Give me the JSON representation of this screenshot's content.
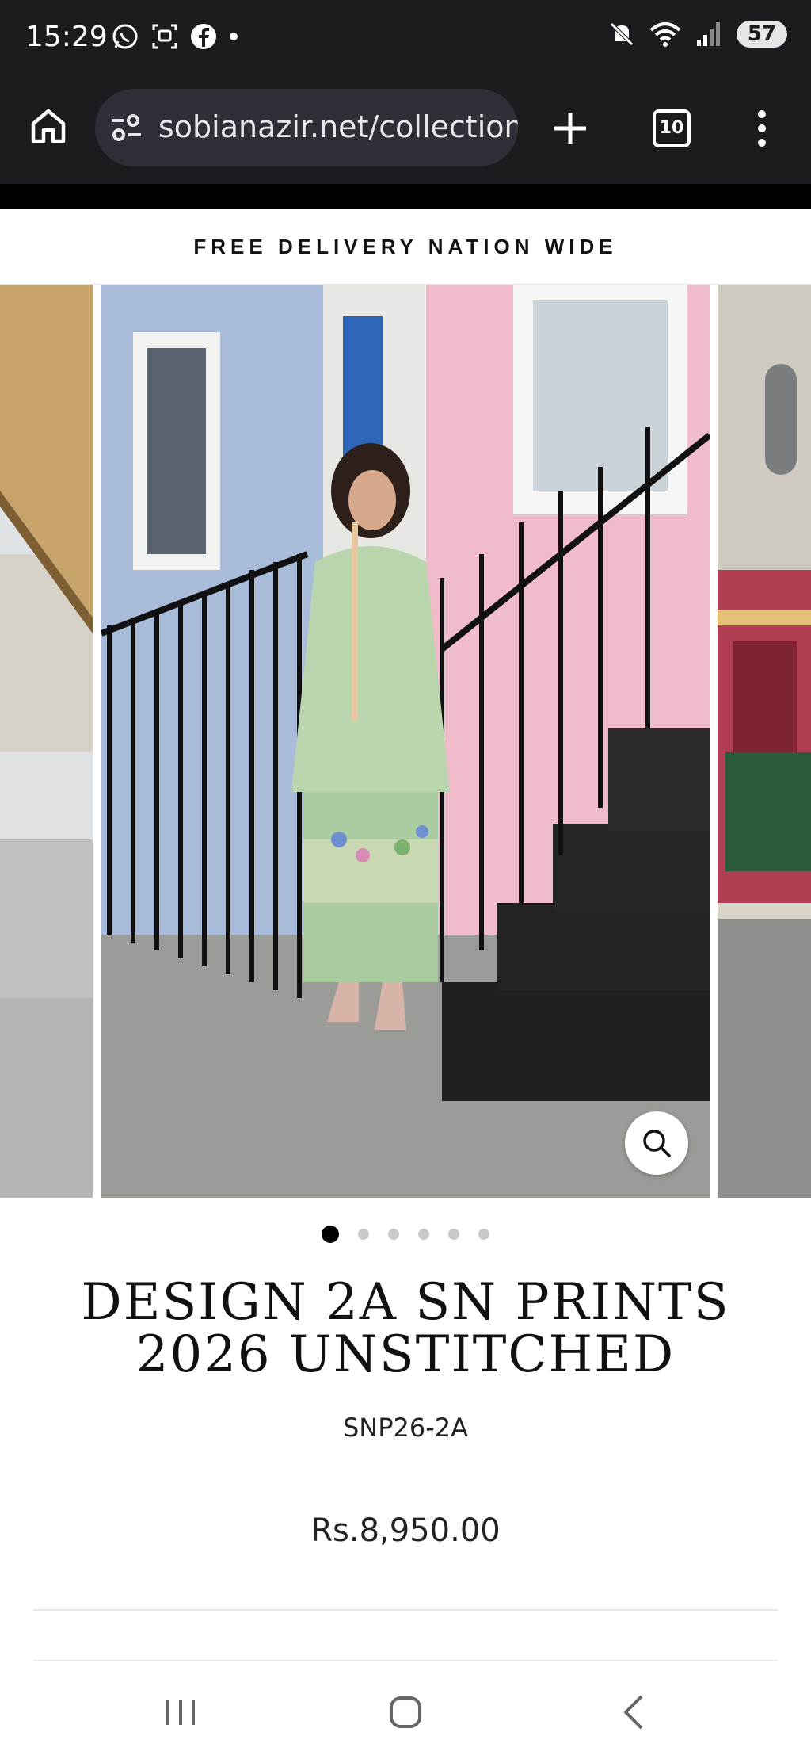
{
  "status_bar": {
    "time": "15:29",
    "battery": "57",
    "left_icons": [
      "whatsapp-icon",
      "screenshot-icon",
      "facebook-icon",
      "dot-icon"
    ],
    "right_icons": [
      "mute-icon",
      "wifi-icon",
      "signal-icon",
      "battery-icon"
    ]
  },
  "browser": {
    "url": "sobianazir.net/collections/",
    "tab_count": "10"
  },
  "announcement": {
    "text": "FREE DELIVERY NATION WIDE"
  },
  "gallery": {
    "slide_count": 6,
    "active_slide": 1
  },
  "product": {
    "title_line1": "DESIGN 2A SN PRINTS",
    "title_line2": "2026 UNSTITCHED",
    "sku": "SNP26-2A",
    "price": "Rs.8,950.00"
  },
  "colors": {
    "chrome_dark": "#1c1b1f",
    "url_pill": "#2f3037",
    "accent_black": "#000000"
  }
}
